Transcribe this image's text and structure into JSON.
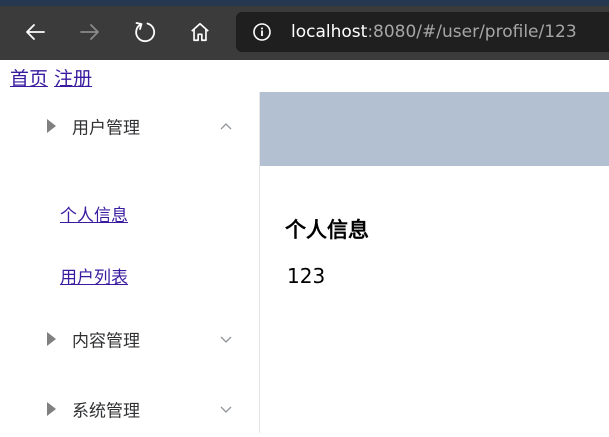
{
  "browser": {
    "url_host": "localhost",
    "url_rest": ":8080/#/user/profile/123",
    "icons": {
      "back": "back-arrow-icon",
      "forward": "forward-arrow-icon",
      "refresh": "refresh-icon",
      "home": "home-icon",
      "info": "info-icon"
    }
  },
  "top_links": {
    "home": "首页",
    "register": "注册"
  },
  "sidebar": {
    "menus": [
      {
        "label": "用户管理",
        "expanded": true,
        "items": [
          {
            "label": "个人信息"
          },
          {
            "label": "用户列表"
          }
        ]
      },
      {
        "label": "内容管理",
        "expanded": false
      },
      {
        "label": "系统管理",
        "expanded": false
      }
    ]
  },
  "main": {
    "header_color": "#b3c0d1",
    "title": "个人信息",
    "user_id": "123"
  },
  "colors": {
    "link": "#3a1ba0",
    "browser_bar": "#3b3b3b",
    "address_bar": "#1f1f1f"
  }
}
